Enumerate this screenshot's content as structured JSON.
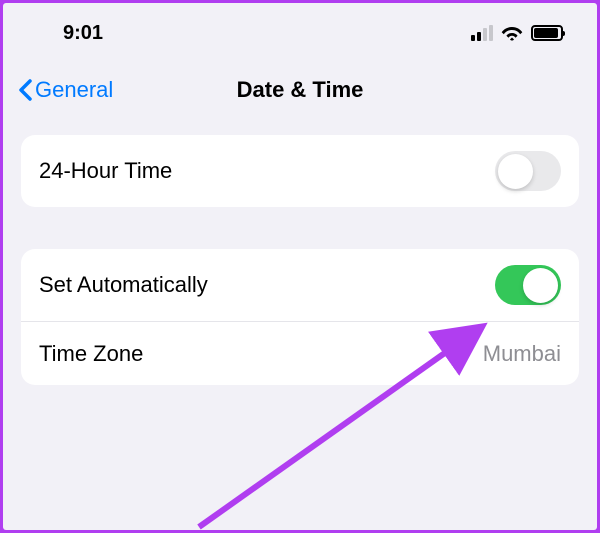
{
  "status": {
    "time": "9:01"
  },
  "nav": {
    "back_label": "General",
    "title": "Date & Time"
  },
  "group1": {
    "row0": {
      "label": "24-Hour Time"
    }
  },
  "group2": {
    "row0": {
      "label": "Set Automatically"
    },
    "row1": {
      "label": "Time Zone",
      "value": "Mumbai"
    }
  }
}
